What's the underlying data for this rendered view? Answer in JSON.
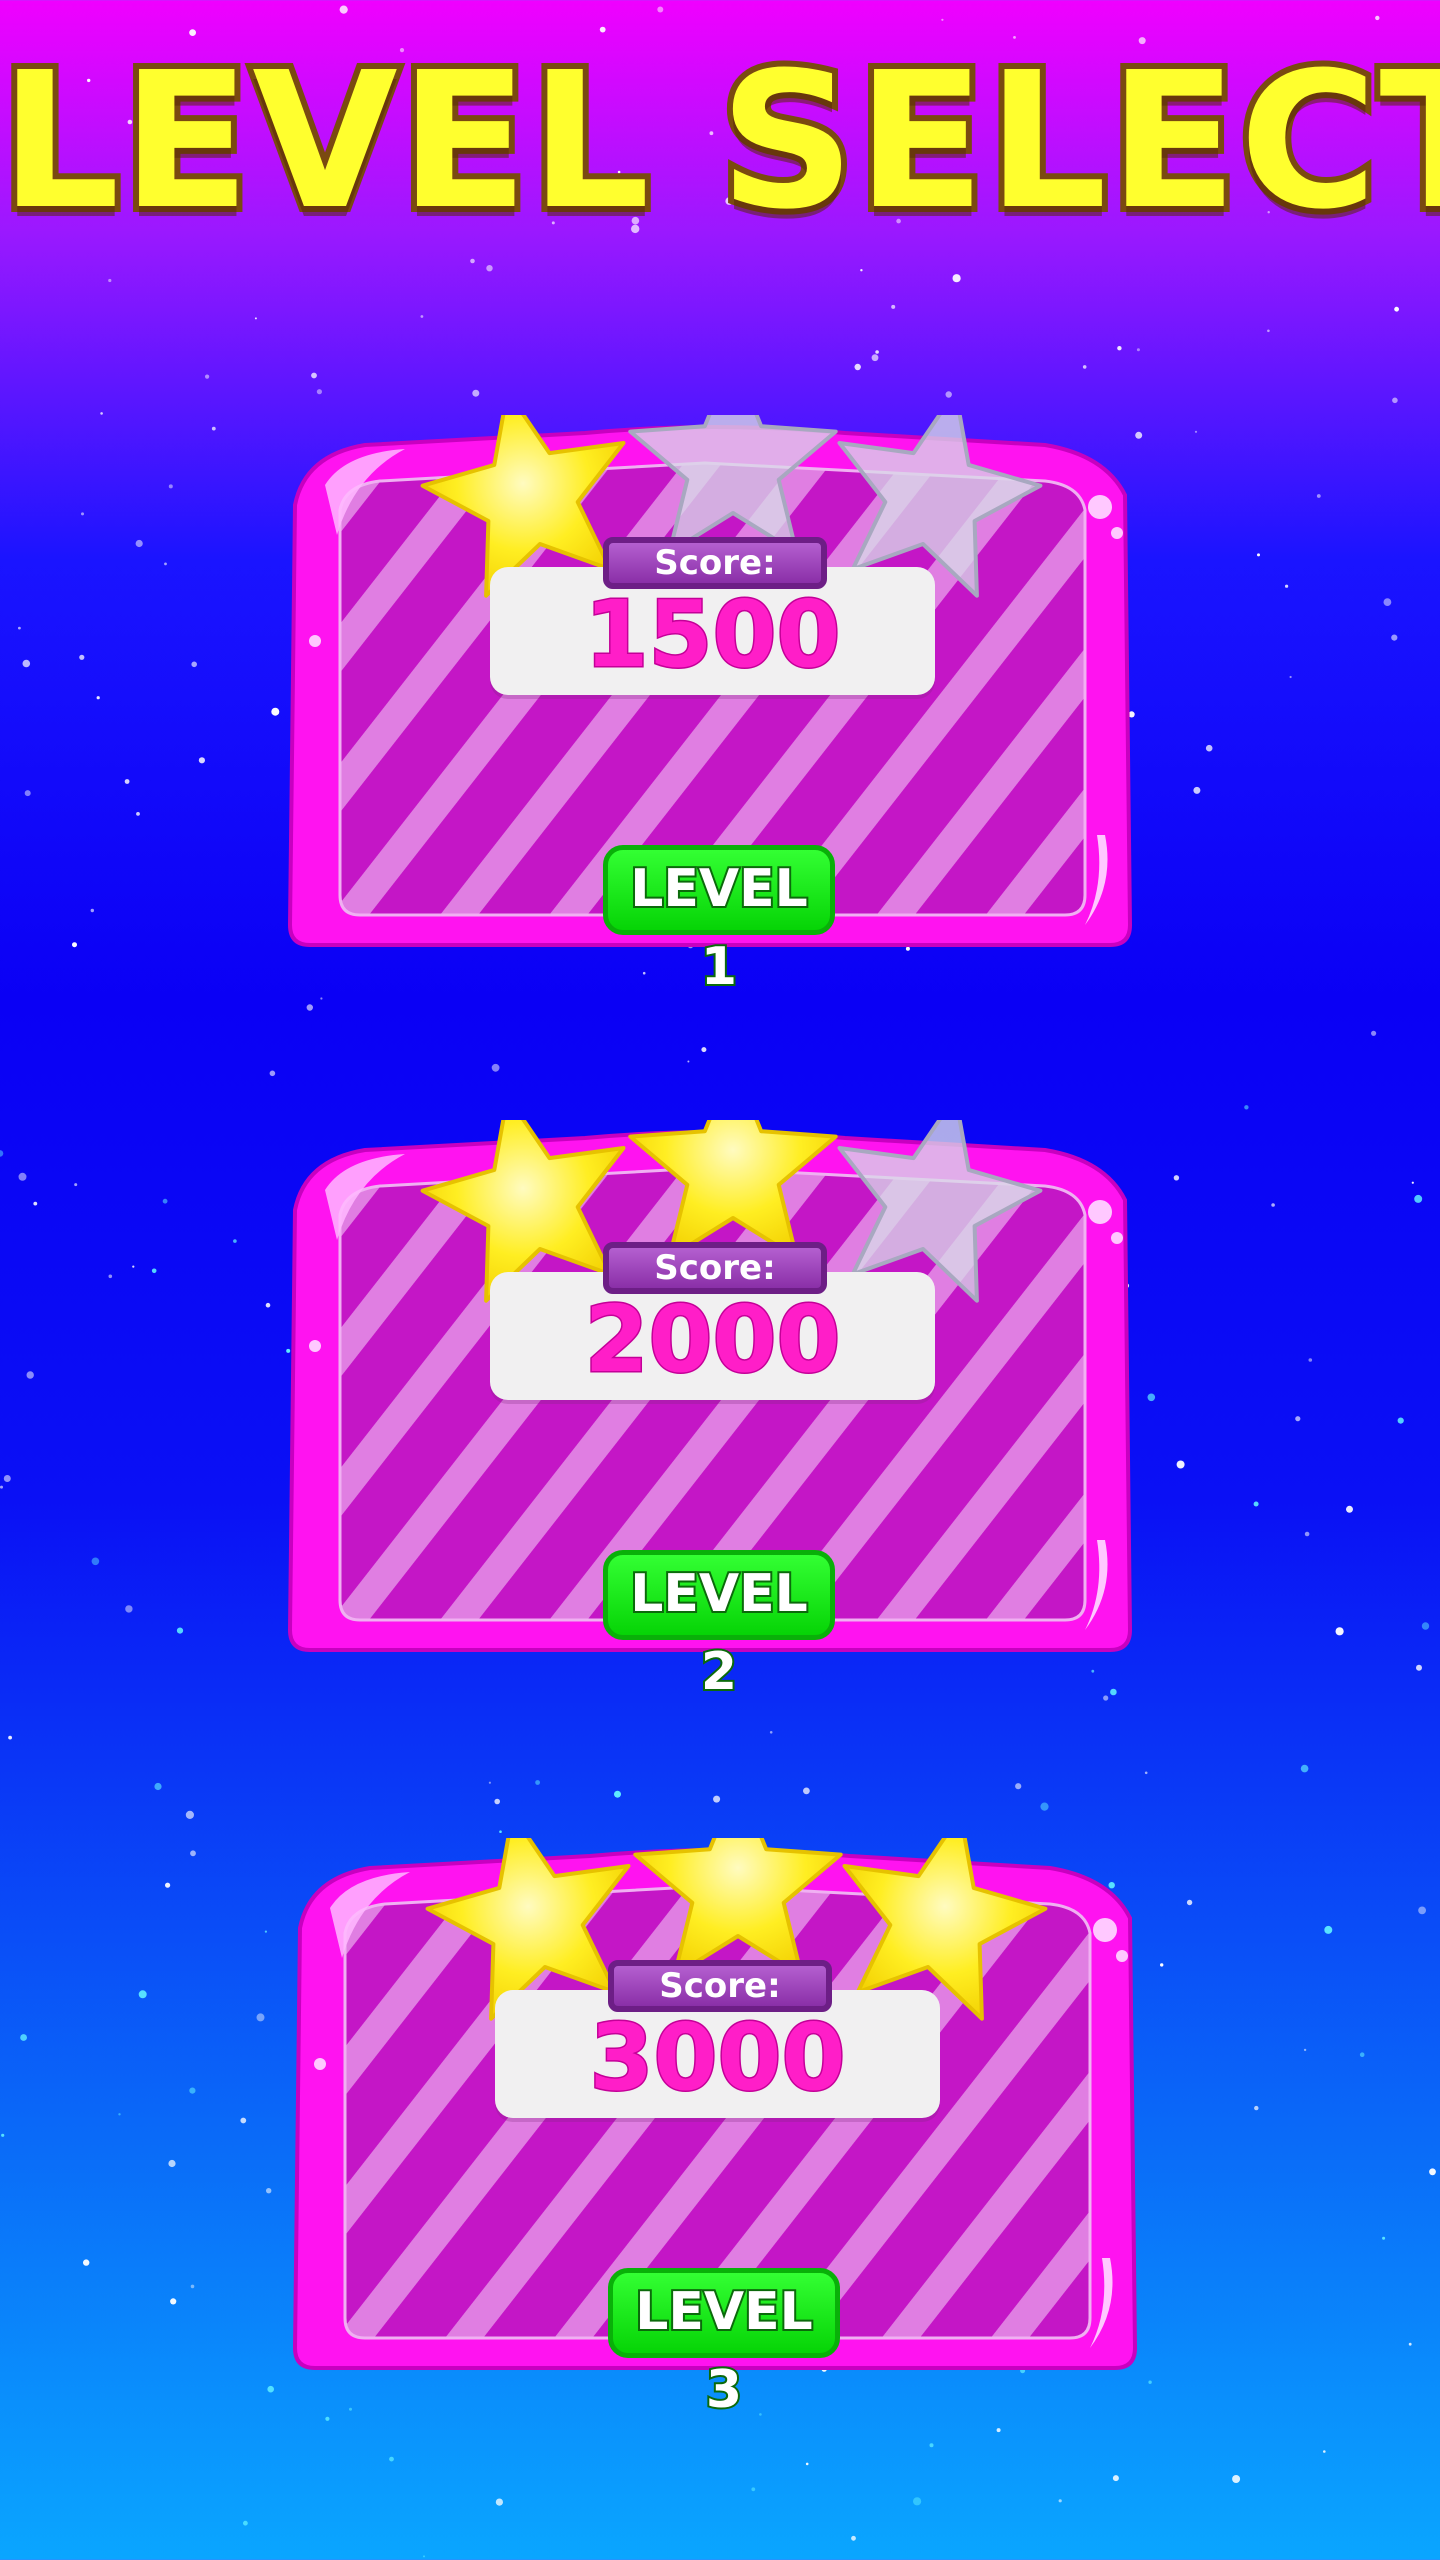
{
  "title": "LEVEL SELECT",
  "colors": {
    "star_earned": "#ffee22",
    "star_empty": "#d8d8e8",
    "card_pink": "#ff13f0",
    "card_inner": "#c416c6",
    "score_text": "#ff1ec8",
    "level_button": "#22ee22"
  },
  "levels": [
    {
      "score_label": "Score:",
      "score": "1500",
      "button_label": "LEVEL 1",
      "stars_earned": 1,
      "stars_total": 3
    },
    {
      "score_label": "Score:",
      "score": "2000",
      "button_label": "LEVEL 2",
      "stars_earned": 2,
      "stars_total": 3
    },
    {
      "score_label": "Score:",
      "score": "3000",
      "button_label": "LEVEL 3",
      "stars_earned": 3,
      "stars_total": 3
    }
  ]
}
